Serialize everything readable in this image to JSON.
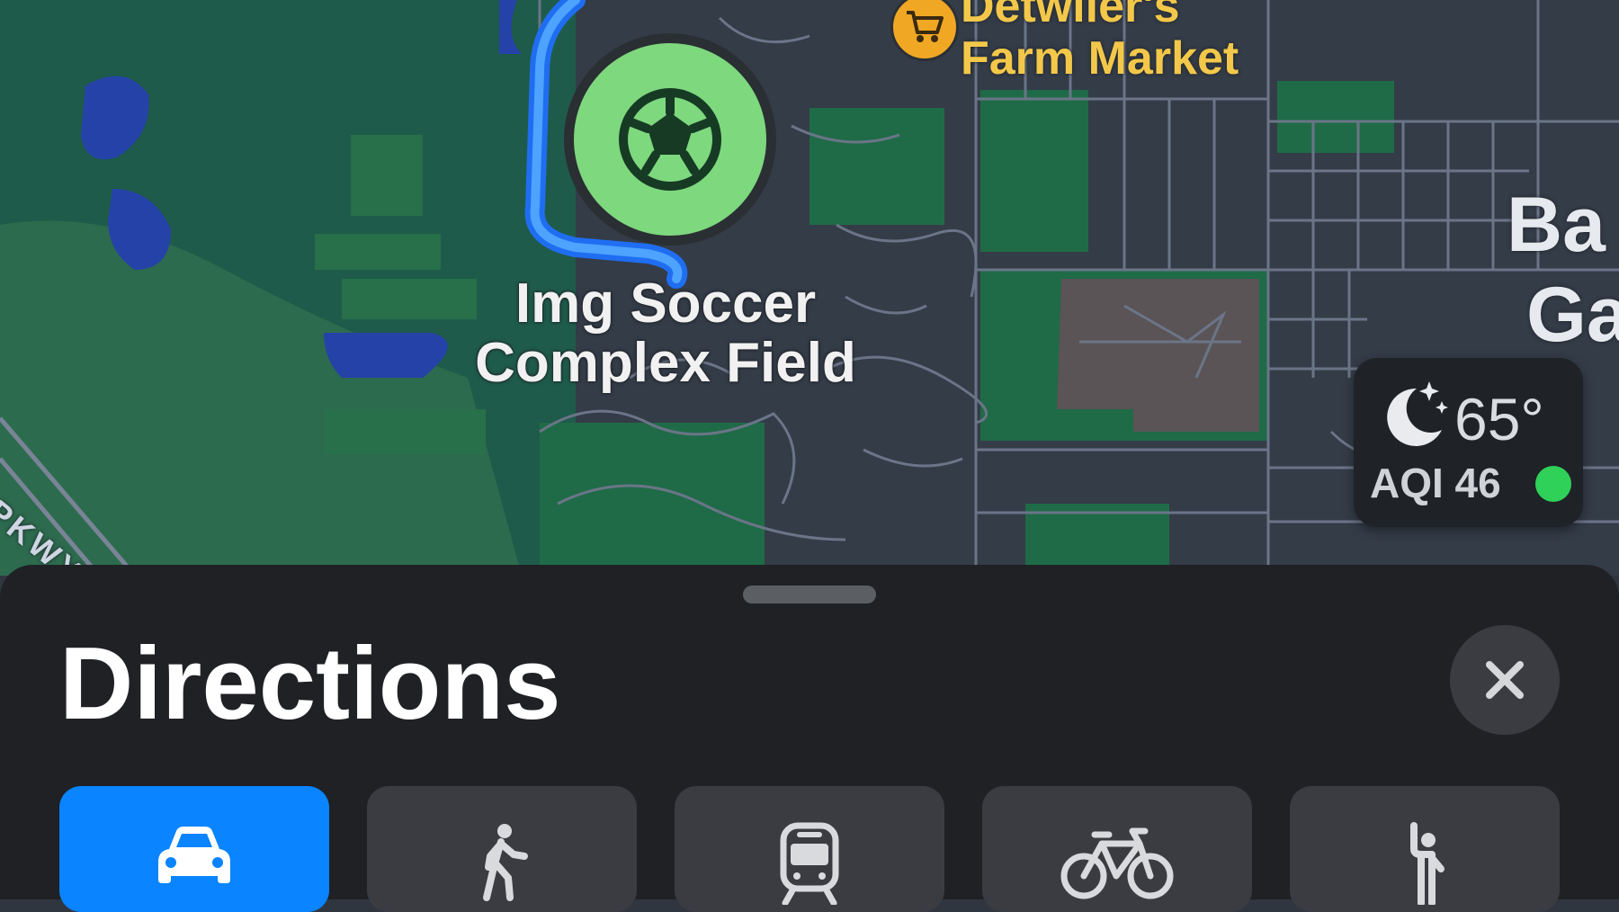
{
  "map": {
    "poi": {
      "name": "Img Soccer Complex Field",
      "line1": "Img Soccer",
      "line2": "Complex Field",
      "icon": "soccer-ball-icon",
      "color": "#7ed87e"
    },
    "farm_market": {
      "line1": "Detwiler's",
      "line2": "Farm Market",
      "icon": "shopping-cart-icon",
      "color": "#f3c84a"
    },
    "area_label": {
      "line1": "Ba",
      "line2": "Ga"
    },
    "road_label": "R PKWY",
    "route_color": "#2d7cf6"
  },
  "weather": {
    "icon": "moon-stars-icon",
    "temperature": "65°",
    "aqi": "AQI 46",
    "aqi_color": "#2fd158"
  },
  "sheet": {
    "title": "Directions",
    "close_icon": "close-icon",
    "modes": [
      {
        "id": "drive",
        "icon": "car-icon",
        "selected": true
      },
      {
        "id": "walk",
        "icon": "walking-person-icon",
        "selected": false
      },
      {
        "id": "transit",
        "icon": "train-icon",
        "selected": false
      },
      {
        "id": "cycle",
        "icon": "bicycle-icon",
        "selected": false
      },
      {
        "id": "rideshare",
        "icon": "hailing-person-icon",
        "selected": false
      }
    ],
    "selected_color": "#0a84ff"
  }
}
